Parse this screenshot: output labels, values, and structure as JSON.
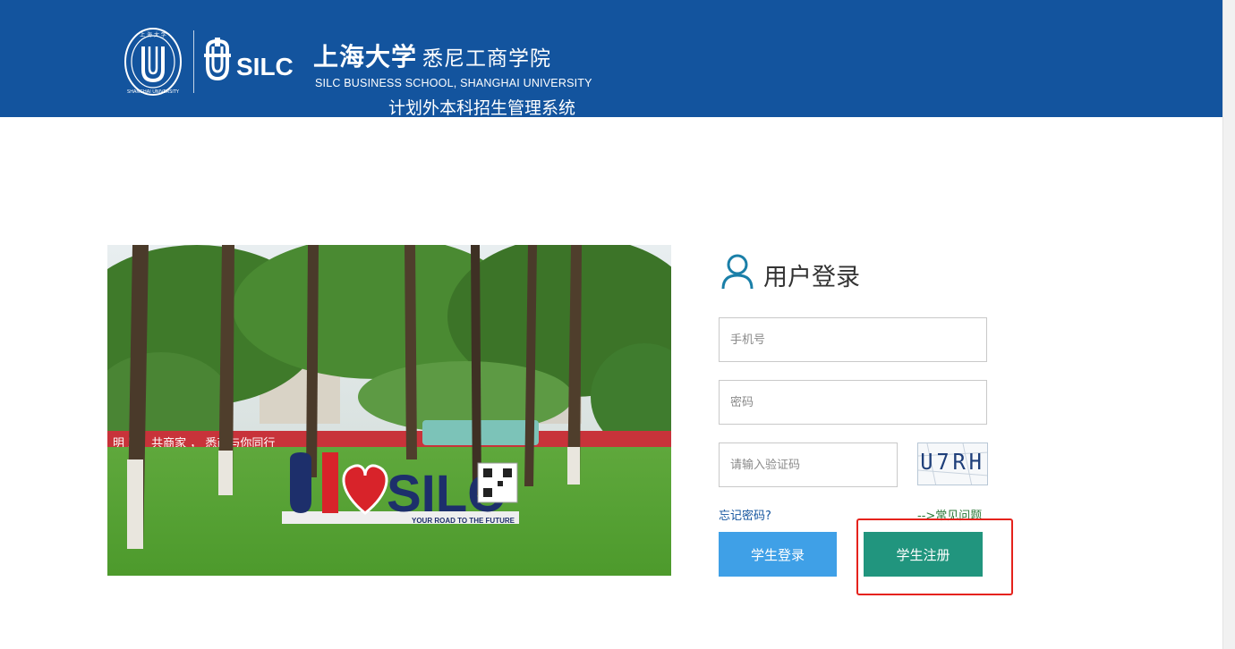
{
  "header": {
    "title_cn_main": "上海大学",
    "title_cn_sub": "悉尼工商学院",
    "title_en": "SILC BUSINESS SCHOOL, SHANGHAI UNIVERSITY",
    "system_name": "计划外本科招生管理系统",
    "logo_text": "SILC",
    "seal_text": "SHANGHAI UNIVERSITY",
    "background_color": "#13549e"
  },
  "photo": {
    "banner_text": "明 路，共商家 ， 悉商与你同行",
    "sign_text": "SILC",
    "slogan": "YOUR ROAD TO THE FUTURE"
  },
  "login": {
    "heading": "用户登录",
    "phone_placeholder": "手机号",
    "password_placeholder": "密码",
    "captcha_placeholder": "请输入验证码",
    "captcha_text": "U7RH",
    "forgot_password": "忘记密码?",
    "faq": "-->常见问题",
    "login_button": "学生登录",
    "register_button": "学生注册"
  },
  "colors": {
    "login_button": "#3fa0e7",
    "register_button": "#21957e",
    "highlight": "#e5221c"
  },
  "icons": [
    "user-icon",
    "sjtu-seal-logo",
    "silc-logo"
  ]
}
